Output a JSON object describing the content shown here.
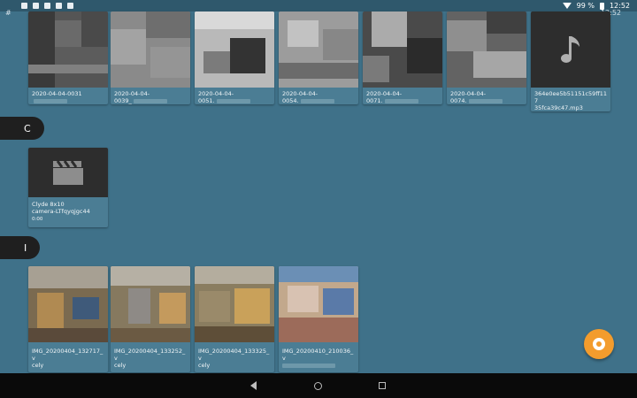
{
  "status_bar": {
    "battery": "99 %",
    "time": "12:52",
    "time_secondary": "12:52"
  },
  "sections": {
    "top": {
      "letter": "#"
    },
    "c": {
      "letter": "C"
    },
    "i": {
      "letter": "I"
    }
  },
  "row1": [
    {
      "name": "2020-04-04-0031"
    },
    {
      "name": "2020-04-04-\n0039_"
    },
    {
      "name": "2020-04-04-\n0051."
    },
    {
      "name": "2020-04-04-\n0054."
    },
    {
      "name": "2020-04-04-\n0071."
    },
    {
      "name": "2020-04-04-\n0074."
    },
    {
      "name": "364e0ee5b51151c59ff117\n35fca39c47.mp3"
    }
  ],
  "row2": [
    {
      "name": "Clyde 8x10\ncamera-LTfqyqjgc44",
      "sub": "0:00"
    }
  ],
  "row3": [
    {
      "name": "IMG_20200404_132717_v\ncely"
    },
    {
      "name": "IMG_20200404_133252_v\ncely"
    },
    {
      "name": "IMG_20200404_133325_v\ncely"
    },
    {
      "name": "IMG_20200410_210036_v"
    }
  ],
  "colors": {
    "background": "#3f7189",
    "accent": "#f39c2d",
    "section_pill": "#1f1f1f"
  },
  "icons": {
    "music": "music-note-icon",
    "video": "clapperboard-icon",
    "fab": "settings-ring-icon"
  }
}
